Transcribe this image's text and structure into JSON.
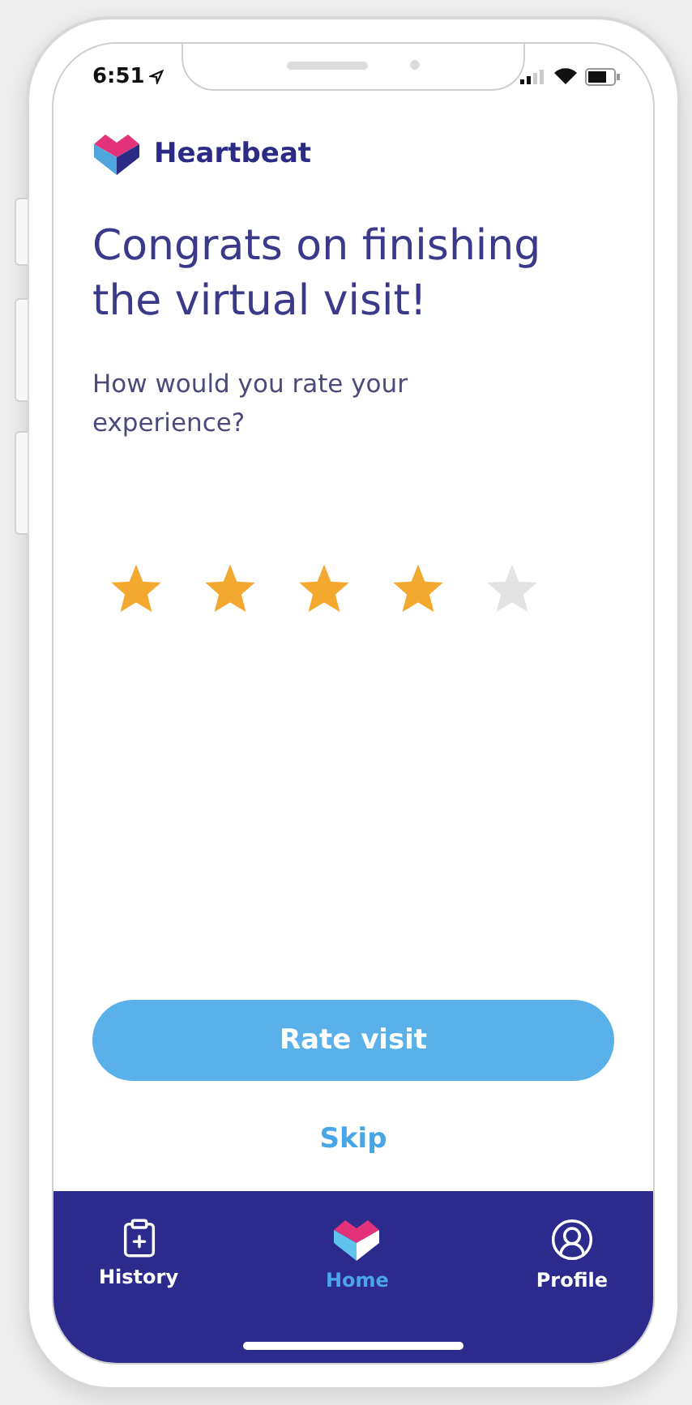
{
  "status_bar": {
    "time": "6:51"
  },
  "app": {
    "name": "Heartbeat"
  },
  "heading": "Congrats on finishing the virtual visit!",
  "prompt": "How would you rate your experience?",
  "rating": {
    "stars": 4
  },
  "buttons": {
    "primary": "Rate visit",
    "secondary": "Skip"
  },
  "tabs": [
    {
      "label": "History",
      "kind": "clipboard",
      "selected": false
    },
    {
      "label": "Home",
      "kind": "heart",
      "selected": true
    },
    {
      "label": "Profile",
      "kind": "person",
      "selected": false
    }
  ]
}
